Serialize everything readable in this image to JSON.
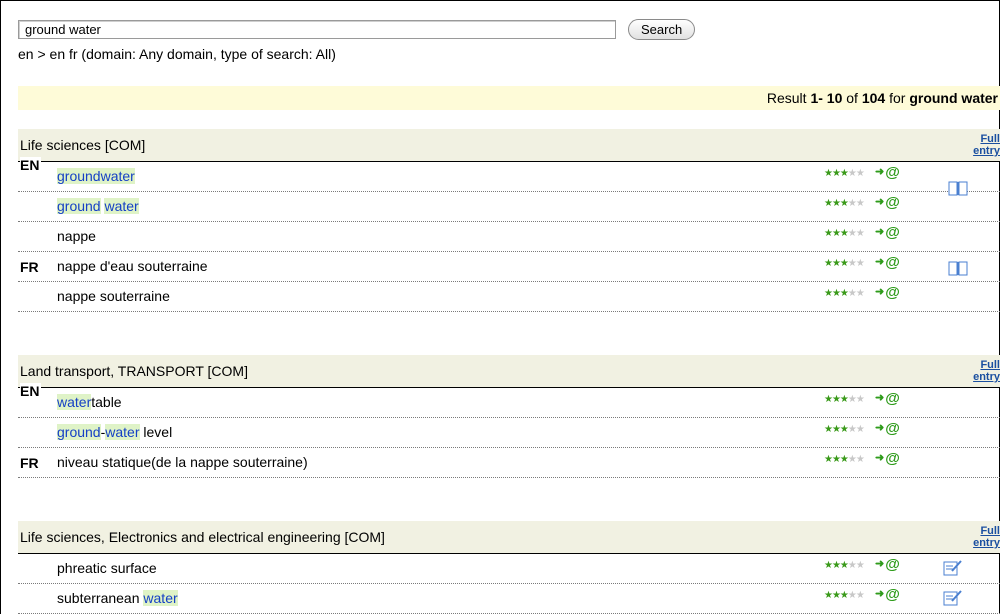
{
  "search": {
    "value": "ground water",
    "button_label": "Search",
    "language_line": "en > en fr (domain: Any domain, type of search: All)"
  },
  "results": {
    "prefix": "Result ",
    "range": "1- 10",
    "of": " of ",
    "total": "104",
    "for": " for ",
    "query": "ground water"
  },
  "full_entry_label_1": "Full",
  "full_entry_label_2": "entry",
  "sections": [
    {
      "title": "Life sciences [COM]",
      "langs": {
        "en": "EN",
        "fr": "FR"
      },
      "rows": [
        {
          "parts": [
            "groundwater"
          ],
          "rating": 3
        },
        {
          "parts": [
            "ground",
            " ",
            "water"
          ],
          "rating": 3
        },
        {
          "text": "nappe",
          "rating": 3
        },
        {
          "text": "nappe d'eau souterraine",
          "rating": 3
        },
        {
          "text": "nappe souterraine",
          "rating": 3
        }
      ]
    },
    {
      "title": "Land transport, TRANSPORT [COM]",
      "langs": {
        "en": "EN",
        "fr": "FR"
      },
      "rows": [
        {
          "parts": [
            "water",
            "table"
          ],
          "rating": 3
        },
        {
          "parts": [
            "ground",
            "-",
            "water",
            " level"
          ],
          "rating": 3
        },
        {
          "text": "niveau statique(de la nappe souterraine)",
          "rating": 3
        }
      ]
    },
    {
      "title": "Life sciences, Electronics and electrical engineering [COM]",
      "rows": [
        {
          "text": "phreatic surface",
          "rating": 3
        },
        {
          "parts": [
            "subterranean ",
            "water"
          ],
          "rating": 3
        }
      ]
    }
  ],
  "icons": {
    "stars": "rating-stars-icon",
    "add": "add-to-mylist-icon",
    "book": "dictionary-book-icon",
    "note": "edit-note-icon"
  },
  "colors": {
    "link": "#1540c6",
    "highlight": "#dff3c7",
    "result_bar": "#fefbd8",
    "section_header": "#f1f1e2",
    "star_on": "#3a9a1a"
  }
}
